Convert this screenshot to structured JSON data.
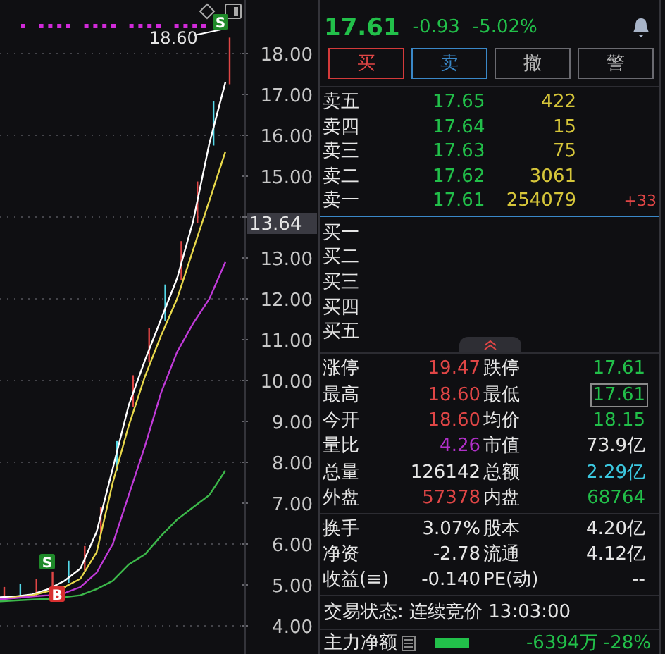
{
  "chart": {
    "current_price_tag": "13.64",
    "high_label": "18.60",
    "markers": [
      {
        "text": "S",
        "kind": "sell"
      },
      {
        "text": "S",
        "kind": "sell"
      },
      {
        "text": "B",
        "kind": "buy"
      }
    ],
    "y_axis_labels": [
      "18.00",
      "17.00",
      "16.00",
      "15.00",
      "13.00",
      "12.00",
      "11.00",
      "10.00",
      "9.00",
      "8.00",
      "7.00",
      "6.00",
      "5.00",
      "4.00"
    ]
  },
  "quote": {
    "price": "17.61",
    "change": "-0.93",
    "change_pct": "-5.02%"
  },
  "buttons": [
    {
      "label": "买",
      "kind": "buy"
    },
    {
      "label": "卖",
      "kind": "sell"
    },
    {
      "label": "撤",
      "kind": "plain"
    },
    {
      "label": "警",
      "kind": "plain"
    }
  ],
  "asks": [
    {
      "label": "卖五",
      "price": "17.65",
      "volume": "422"
    },
    {
      "label": "卖四",
      "price": "17.64",
      "volume": "15"
    },
    {
      "label": "卖三",
      "price": "17.63",
      "volume": "75"
    },
    {
      "label": "卖二",
      "price": "17.62",
      "volume": "3061"
    },
    {
      "label": "卖一",
      "price": "17.61",
      "volume": "254079",
      "delta": "+33"
    }
  ],
  "bids": [
    {
      "label": "买一"
    },
    {
      "label": "买二"
    },
    {
      "label": "买三"
    },
    {
      "label": "买四"
    },
    {
      "label": "买五"
    }
  ],
  "stats": [
    [
      {
        "label": "涨停",
        "value": "19.47",
        "color": "#e04646"
      },
      {
        "label": "跌停",
        "value": "17.61",
        "color": "#22c04a"
      }
    ],
    [
      {
        "label": "最高",
        "value": "18.60",
        "color": "#e04646"
      },
      {
        "label": "最低",
        "value": "17.61",
        "color": "#22c04a",
        "boxed": true
      }
    ],
    [
      {
        "label": "今开",
        "value": "18.60",
        "color": "#e04646"
      },
      {
        "label": "均价",
        "value": "18.15",
        "color": "#22c04a"
      }
    ],
    [
      {
        "label": "量比",
        "value": "4.26",
        "color": "#b030c8"
      },
      {
        "label": "市值",
        "value": "73.9亿",
        "color": "#e6e6e6"
      }
    ],
    [
      {
        "label": "总量",
        "value": "126142",
        "color": "#e6e6e6"
      },
      {
        "label": "总额",
        "value": "2.29亿",
        "color": "#3cc8e0"
      }
    ],
    [
      {
        "label": "外盘",
        "value": "57378",
        "color": "#e04646"
      },
      {
        "label": "内盘",
        "value": "68764",
        "color": "#22c04a"
      }
    ]
  ],
  "fundamentals": [
    [
      {
        "label": "换手",
        "value": "3.07%"
      },
      {
        "label": "股本",
        "value": "4.20亿"
      }
    ],
    [
      {
        "label": "净资",
        "value": "-2.78"
      },
      {
        "label": "流通",
        "value": "4.12亿"
      }
    ],
    [
      {
        "label": "收益(≡)",
        "value": "-0.140"
      },
      {
        "label": "PE(动)",
        "value": "--"
      }
    ]
  ],
  "trade_status": "交易状态: 连续竞价 13:03:00",
  "main_flow": {
    "label": "主力净额",
    "amount": "-6394万",
    "pct": "-28%"
  }
}
